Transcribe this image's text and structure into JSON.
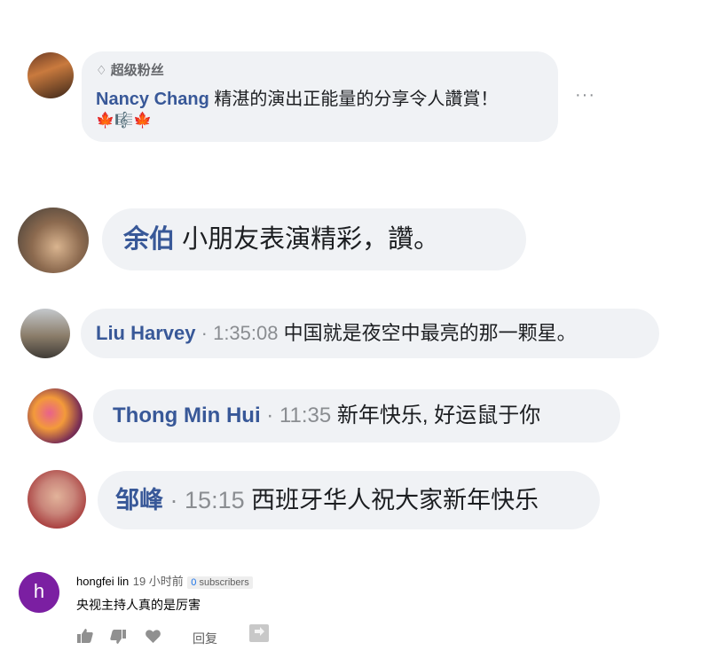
{
  "comments": [
    {
      "badge": "超级粉丝",
      "name": "Nancy Chang",
      "text": "精湛的演出正能量的分享令人讚賞！",
      "emoji": "🍁🎼🍁",
      "more": "···"
    },
    {
      "name": "余伯",
      "text": "小朋友表演精彩，讚。"
    },
    {
      "name": "Liu Harvey",
      "sep": "·",
      "time": "1:35:08",
      "text": "中国就是夜空中最亮的那一颗星。"
    },
    {
      "name": "Thong Min Hui",
      "sep": "·",
      "time": "11:35",
      "text": "新年快乐, 好运鼠于你"
    },
    {
      "name": "邹峰",
      "sep": "·",
      "time": "15:15",
      "text": "西班牙华人祝大家新年快乐"
    }
  ],
  "youtube": {
    "avatar_letter": "h",
    "name": "hongfei lin",
    "time": "19 小时前",
    "subscriber_count": "0",
    "subscriber_label": " subscribers",
    "text": "央视主持人真的是厉害",
    "reply": "回复"
  },
  "colors": {
    "name_blue": "#385898",
    "bubble_bg": "#f0f2f5",
    "yt_avatar": "#7b1fa2"
  }
}
